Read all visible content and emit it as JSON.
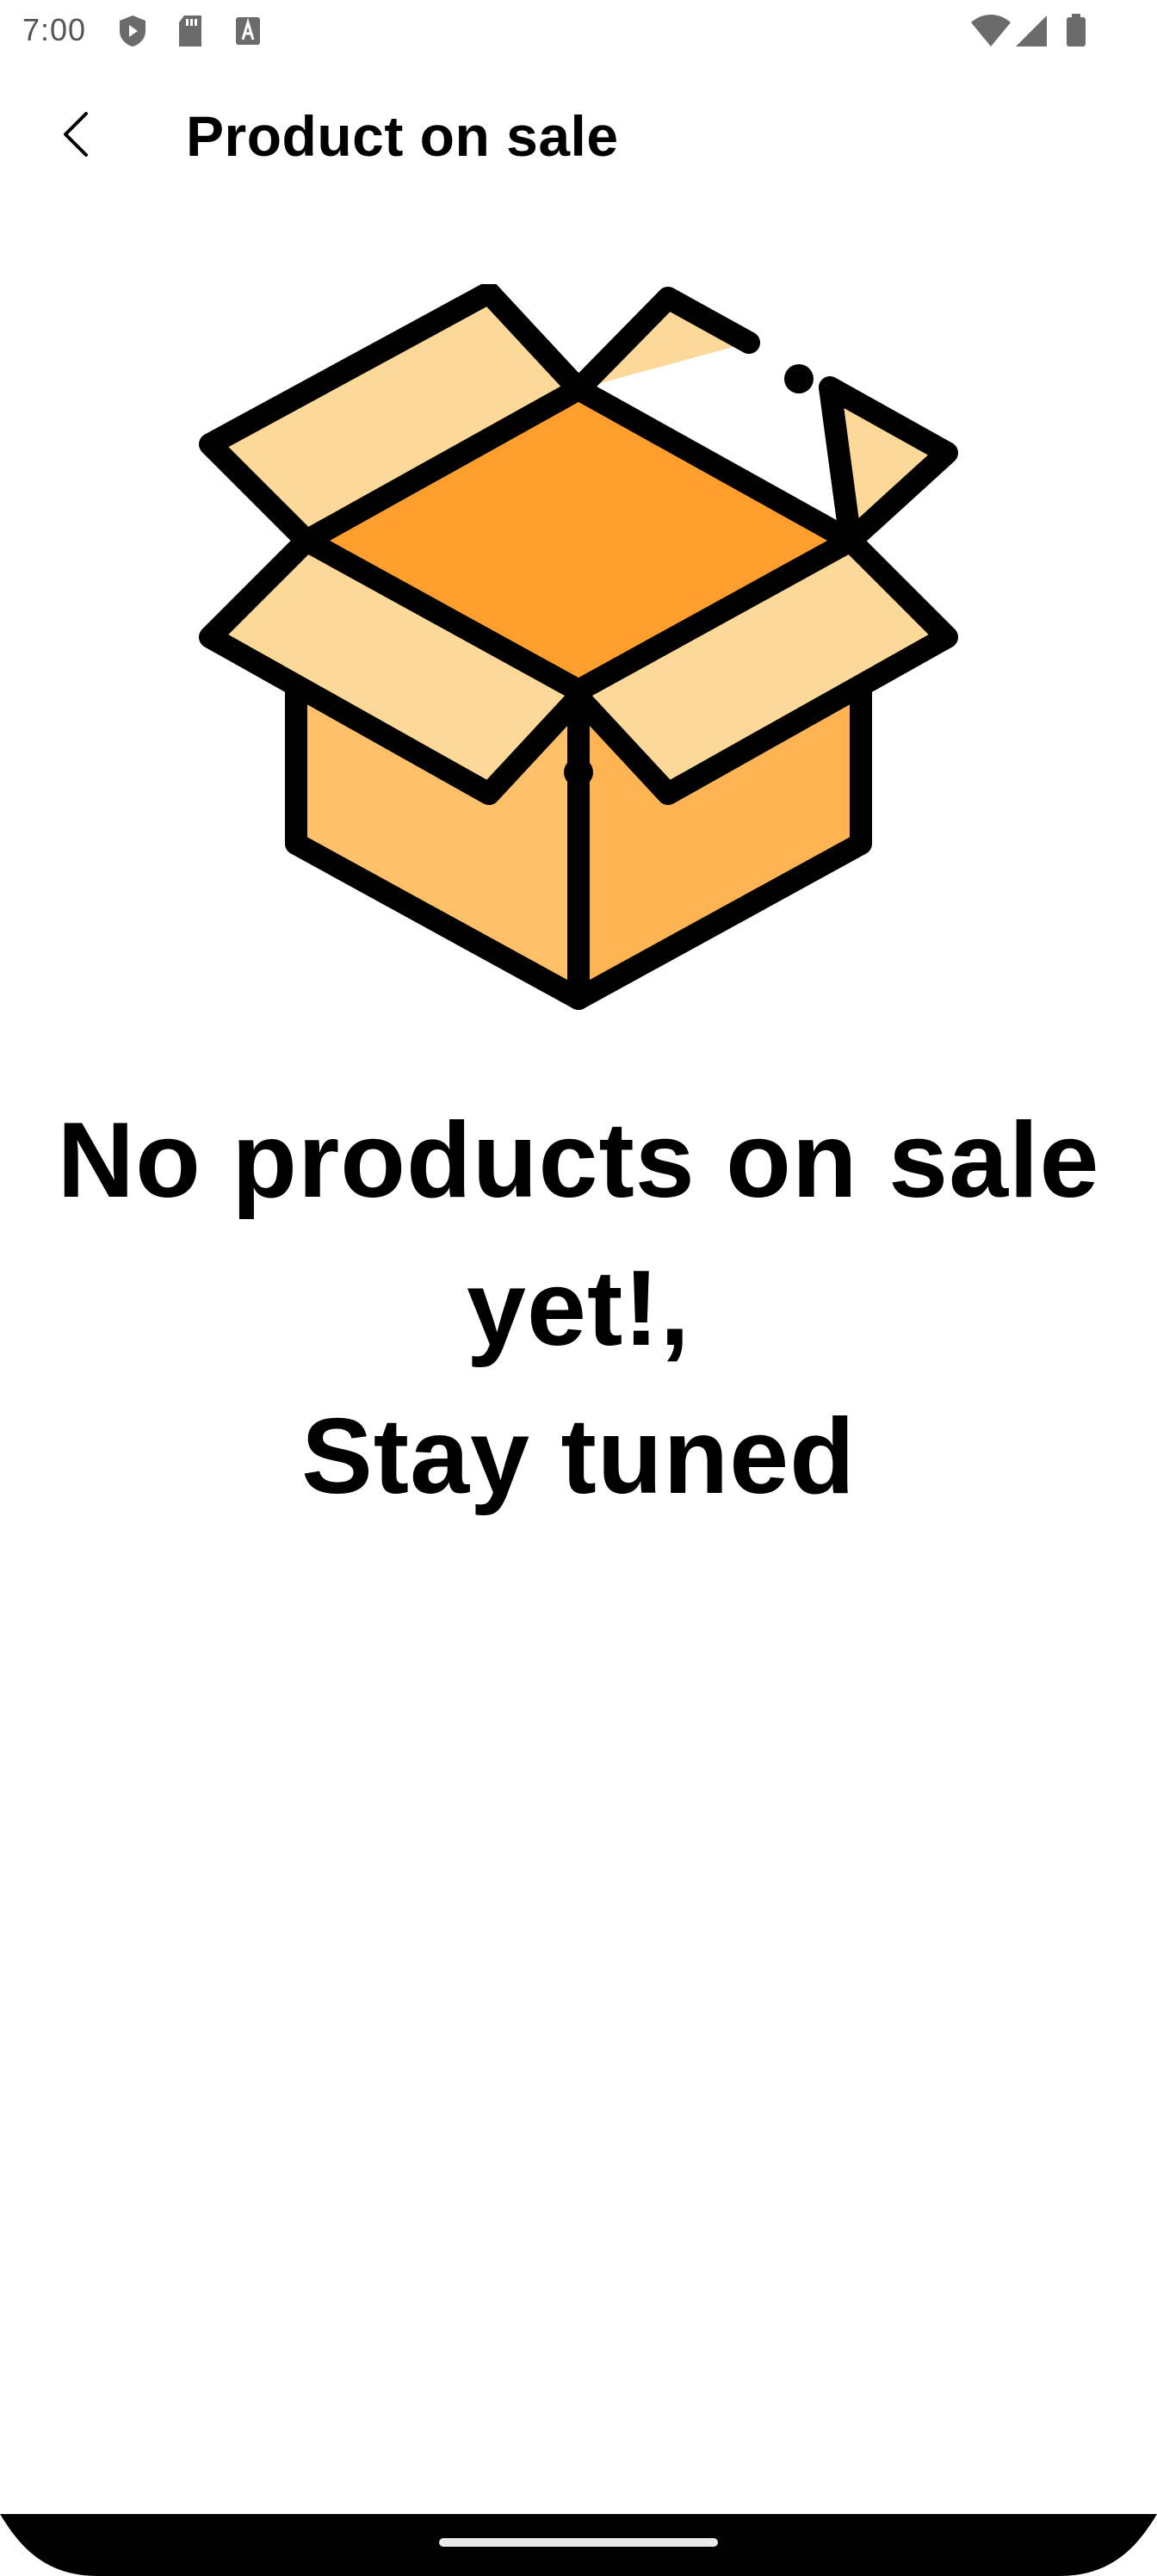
{
  "status_bar": {
    "time": "7:00",
    "icons": [
      "shield-play-icon",
      "sd-card-icon",
      "font-a-icon",
      "wifi-icon",
      "signal-icon",
      "battery-icon"
    ]
  },
  "app_bar": {
    "back_icon": "chevron-left-icon",
    "title": "Product on sale"
  },
  "illustration": {
    "icon": "open-box-icon",
    "colors": {
      "outline": "#000000",
      "flap_light": "#fdd999",
      "inside": "#fe9f2d",
      "side_left": "#fec16a",
      "side_right": "#feb453"
    }
  },
  "empty_state": {
    "line1": "No products on sale",
    "line2": "yet!,",
    "line3": "Stay tuned"
  },
  "nav_bar": {
    "handle": "home-handle"
  }
}
